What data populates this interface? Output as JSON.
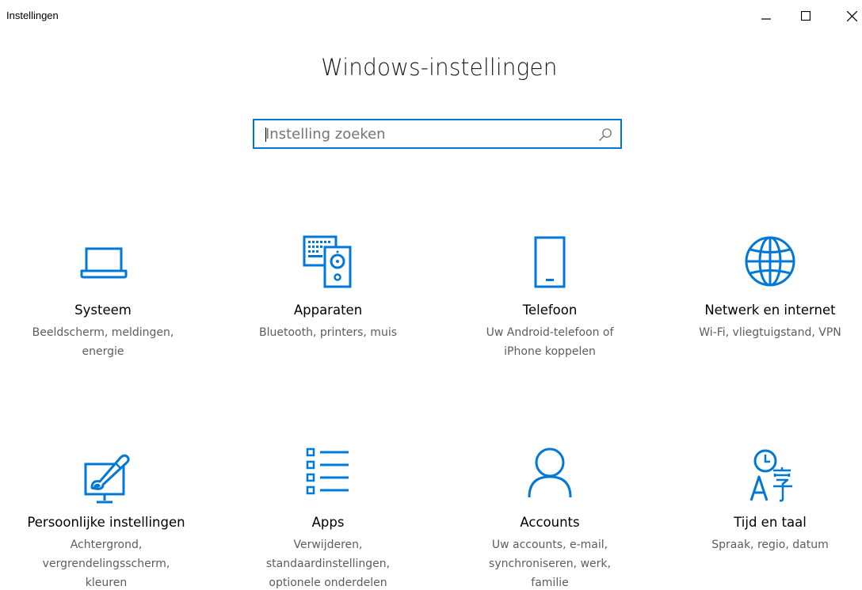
{
  "window": {
    "title": "Instellingen",
    "controls": {
      "minimize": "minimize-icon",
      "maximize": "maximize-icon",
      "close": "close-icon"
    }
  },
  "header": {
    "title": "Windows-instellingen"
  },
  "search": {
    "placeholder": "Instelling zoeken",
    "value": "",
    "icon": "search-icon"
  },
  "colors": {
    "accent": "#0078d7",
    "title": "#1a1a1a",
    "description": "#5d5d5d"
  },
  "categories": [
    {
      "name": "Systeem",
      "desc": [
        "Beeldscherm, meldingen,",
        "energie"
      ],
      "icon": "laptop-icon"
    },
    {
      "name": "Apparaten",
      "desc": [
        "Bluetooth, printers, muis"
      ],
      "icon": "devices-icon"
    },
    {
      "name": "Telefoon",
      "desc": [
        "Uw Android-telefoon of",
        "iPhone koppelen"
      ],
      "icon": "phone-icon"
    },
    {
      "name": "Netwerk en internet",
      "desc": [
        "Wi-Fi, vliegtuigstand, VPN"
      ],
      "icon": "globe-icon"
    },
    {
      "name": "Persoonlijke instellingen",
      "desc": [
        "Achtergrond,",
        "vergrendelingsscherm,",
        "kleuren"
      ],
      "icon": "personalization-icon"
    },
    {
      "name": "Apps",
      "desc": [
        "Verwijderen,",
        "standaardinstellingen,",
        "optionele onderdelen"
      ],
      "icon": "apps-list-icon"
    },
    {
      "name": "Accounts",
      "desc": [
        "Uw accounts, e-mail,",
        "synchroniseren, werk,",
        "familie"
      ],
      "icon": "person-icon"
    },
    {
      "name": "Tijd en taal",
      "desc": [
        "Spraak, regio, datum"
      ],
      "icon": "time-language-icon"
    }
  ]
}
